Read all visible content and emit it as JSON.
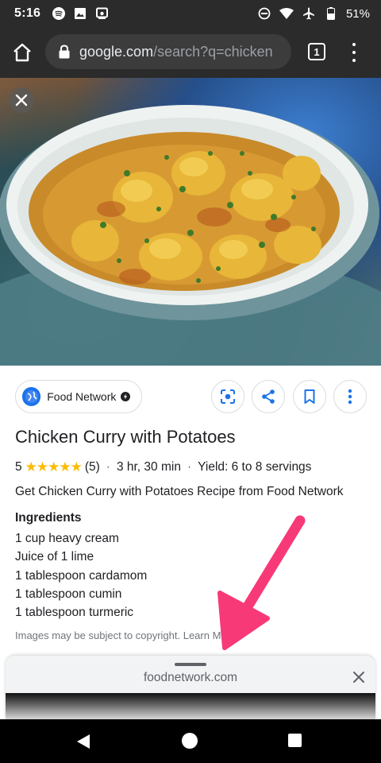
{
  "status_bar": {
    "time": "5:16",
    "left_icons": [
      "spotify-icon",
      "image-icon",
      "cast-icon"
    ],
    "right_icons": [
      "do-not-disturb-icon",
      "wifi-icon",
      "airplane-icon",
      "battery-icon"
    ],
    "battery": "51%"
  },
  "browser": {
    "url_host": "google.com",
    "url_path": "/search?q=chicken",
    "tab_count": "1"
  },
  "result": {
    "source_name": "Food Network",
    "title": "Chicken Curry with Potatoes",
    "rating": "5",
    "stars": "★★★★★",
    "review_count": "(5)",
    "time": "3 hr, 30 min",
    "yield": "Yield: 6 to 8 servings",
    "separator": "·",
    "description": "Get Chicken Curry with Potatoes Recipe from Food Network",
    "ingredients_heading": "Ingredients",
    "ingredients": [
      "1 cup heavy cream",
      "Juice of 1 lime",
      "1 tablespoon cardamom",
      "1 tablespoon cumin",
      "1 tablespoon turmeric"
    ],
    "copyright_text": "Images may be subject to copyright. Learn More"
  },
  "bottom_sheet": {
    "domain": "foodnetwork.com"
  },
  "colors": {
    "annotation_arrow": "#f73a77",
    "star": "#fbbc04",
    "link_blue": "#1a73e8"
  }
}
